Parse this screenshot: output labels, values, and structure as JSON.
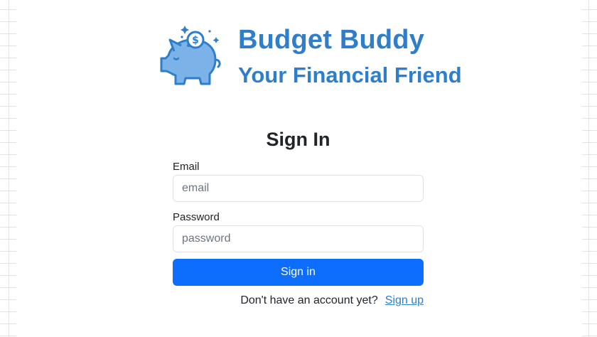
{
  "brand": {
    "title": "Budget Buddy",
    "subtitle": "Your Financial Friend",
    "logo_icon": "piggy-bank-coin-icon",
    "brand_color": "#2e7ecb"
  },
  "signin": {
    "title": "Sign In",
    "email_label": "Email",
    "email_placeholder": "email",
    "email_value": "",
    "password_label": "Password",
    "password_placeholder": "password",
    "password_value": "",
    "submit_label": "Sign in",
    "submit_color": "#0d6efd",
    "no_account_text": "Don't have an account yet?",
    "signup_link": "Sign up"
  }
}
